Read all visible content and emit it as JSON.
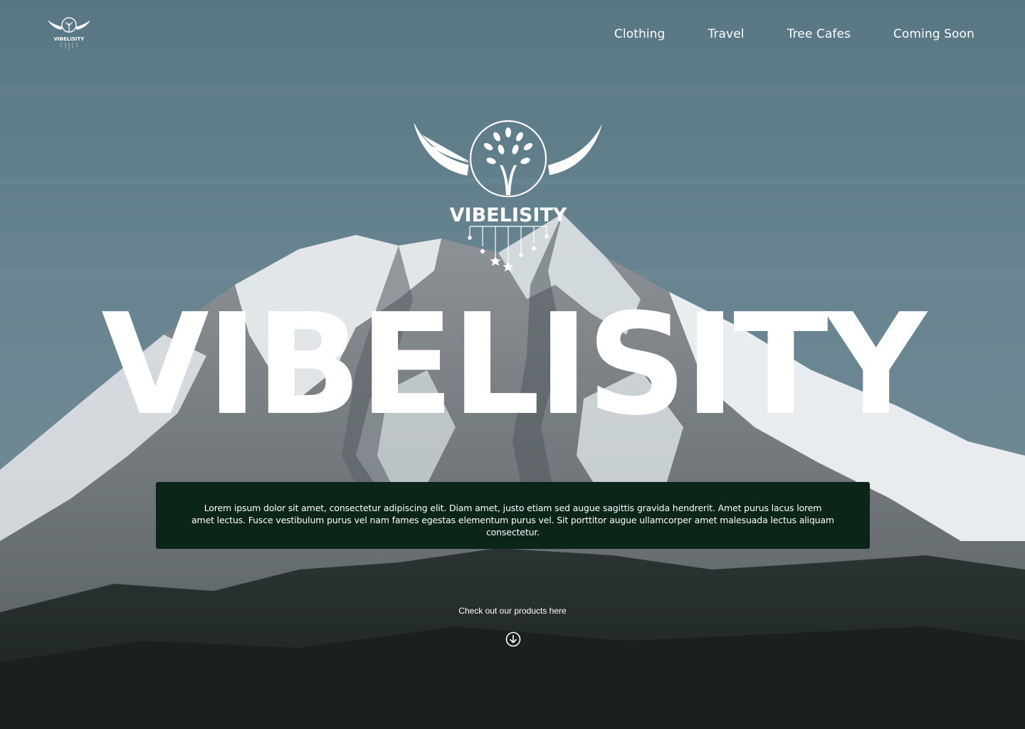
{
  "brand": {
    "name": "VIBELISITY",
    "logo_icon": "winged-tree-emblem"
  },
  "nav": {
    "items": [
      {
        "label": "Clothing"
      },
      {
        "label": "Travel"
      },
      {
        "label": "Tree Cafes"
      },
      {
        "label": "Coming Soon"
      }
    ]
  },
  "hero": {
    "background": "snow-capped-mountain-photo",
    "wordmark": "VIBELISITY",
    "description_line1": "Lorem ipsum dolor sit amet, consectetur adipiscing elit. Diam amet, justo etiam sed augue sagittis gravida hendrerit. Amet purus lacus lorem",
    "description_line2": "amet lectus. Fusce vestibulum purus vel nam fames egestas elementum purus vel. Sit porttitor augue ullamcorper amet malesuada lectus aliquam consectetur.",
    "cta_text": "Check out our products here",
    "cta_icon": "arrow-down-circle-icon"
  },
  "colors": {
    "sky": "#5f7c88",
    "info_box": "#0b2519",
    "text": "#ffffff"
  }
}
